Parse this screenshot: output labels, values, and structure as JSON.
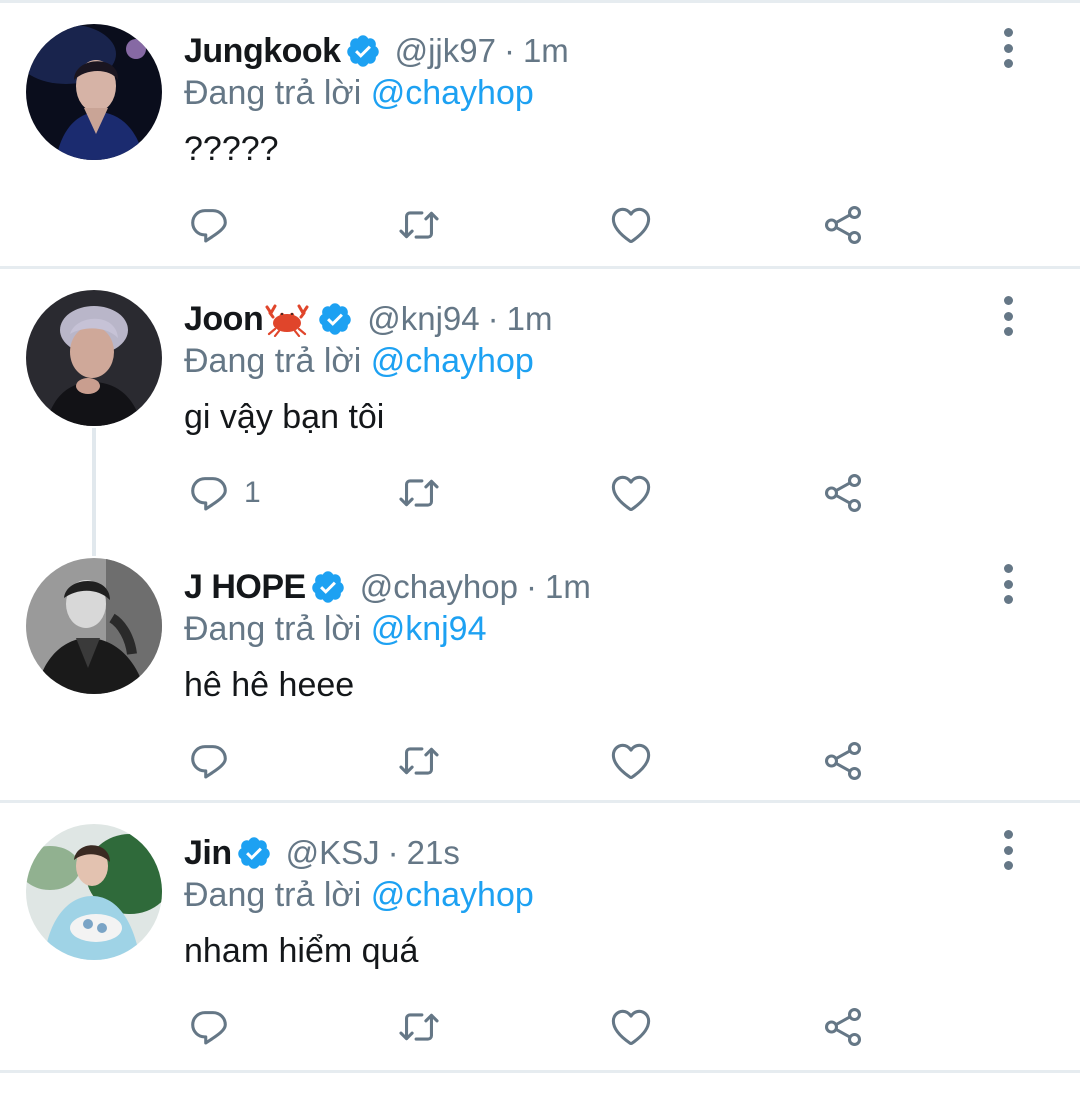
{
  "colors": {
    "text": "#14171a",
    "secondary": "#657786",
    "accent": "#1da1f2",
    "divider": "#e6ecf0"
  },
  "tweets": [
    {
      "name": "Jungkook",
      "verified": true,
      "handle": "@jjk97",
      "separator": "·",
      "time": "1m",
      "reply_prefix": "Đang trả lời ",
      "reply_to": "@chayhop",
      "text": "?????",
      "reply_count": "",
      "avatar": "avatar-jungkook"
    },
    {
      "name": "Joon",
      "name_emoji": "crab-emoji",
      "verified": true,
      "handle": "@knj94",
      "separator": "·",
      "time": "1m",
      "reply_prefix": "Đang trả lời ",
      "reply_to": "@chayhop",
      "text": "gi vậy bạn tôi",
      "reply_count": "1",
      "avatar": "avatar-joon"
    },
    {
      "name": "J HOPE",
      "verified": true,
      "handle": "@chayhop",
      "separator": "·",
      "time": "1m",
      "reply_prefix": "Đang trả lời ",
      "reply_to": "@knj94",
      "text": "hê hê heee",
      "reply_count": "",
      "avatar": "avatar-jhope"
    },
    {
      "name": "Jin",
      "verified": true,
      "handle": "@KSJ",
      "separator": "·",
      "time": "21s",
      "reply_prefix": "Đang trả lời ",
      "reply_to": "@chayhop",
      "text": "nham hiểm quá",
      "reply_count": "",
      "avatar": "avatar-jin"
    }
  ],
  "icons": {
    "reply": "reply-icon",
    "retweet": "retweet-icon",
    "like": "heart-icon",
    "share": "share-icon",
    "more": "more-vertical-icon",
    "verified": "verified-badge-icon"
  }
}
